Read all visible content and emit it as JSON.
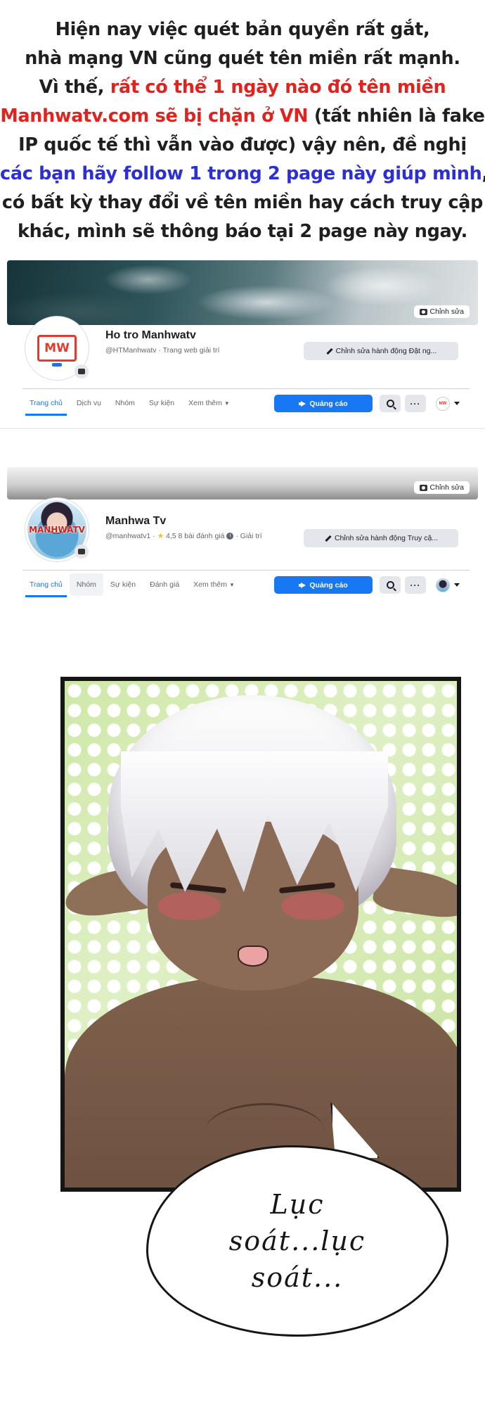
{
  "notice": {
    "line1": "Hiện nay việc quét bản quyền rất gắt,",
    "line2": "nhà mạng VN cũng quét tên miền rất mạnh.",
    "line3_prefix": "Vì thế, ",
    "line3_red": "rất có thể 1 ngày nào đó tên miền",
    "line4_red": "Manhwatv.com sẽ bị chặn ở VN",
    "line4_suffix": " (tất nhiên là fake",
    "line5": "IP quốc tế thì vẫn vào được) vậy nên, đề nghị",
    "line6_blue": "các bạn hãy follow 1 trong 2 page này giúp mình",
    "line6_suffix": ",",
    "line7": "có bất kỳ thay đổi về tên miền hay cách truy cập",
    "line8": "khác, mình sẽ thông báo tại 2 page này ngay."
  },
  "pages": [
    {
      "edit_cover": "Chỉnh sửa",
      "avatar_text": "MW",
      "name": "Ho tro Manhwatv",
      "handle": "@HTManhwatv · Trang web giải trí",
      "edit_action": "Chỉnh sửa hành động Đặt ng...",
      "tabs": [
        "Trang chủ",
        "Dịch vụ",
        "Nhóm",
        "Sự kiện",
        "Xem thêm"
      ],
      "ad_button": "Quảng cáo",
      "switcher_avatar_text": "MW"
    },
    {
      "edit_cover": "Chỉnh sửa",
      "avatar_text": "MANHWATV",
      "name": "Manhwa Tv",
      "handle": "@manhwatv1 · ",
      "rating": "4,5 8 bài đánh giá",
      "info_mark": "i",
      "category": " · Giải trí",
      "edit_action": "Chỉnh sửa hành động Truy cậ...",
      "tabs": [
        "Trang chủ",
        "Nhóm",
        "Sự kiện",
        "Đánh giá",
        "Xem thêm"
      ],
      "ad_button": "Quảng cáo"
    }
  ],
  "icons": {
    "star": "★",
    "dots": "···",
    "caret": "▼"
  },
  "speech_bubble": {
    "line1": "Lục",
    "line2": "soát...lục",
    "line3": "soát..."
  },
  "colors": {
    "notice_red": "#e0231f",
    "notice_blue": "#2a2fd6",
    "facebook_blue": "#1877f2"
  }
}
